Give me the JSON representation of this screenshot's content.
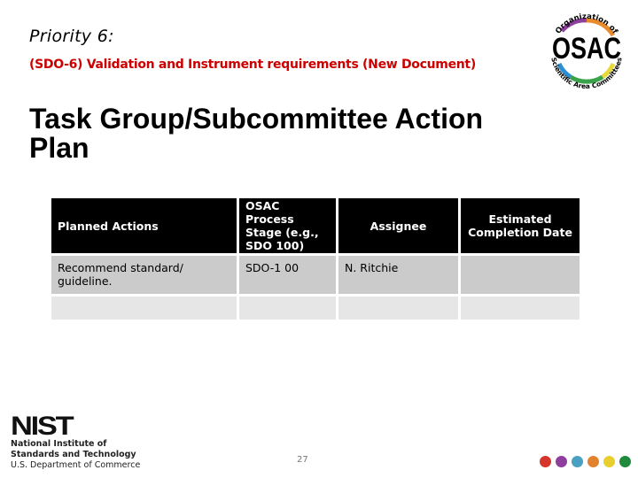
{
  "header": {
    "priority": "Priority 6:",
    "subtitle": "(SDO-6) Validation and Instrument requirements (New Document)",
    "title": "Task Group/Subcommittee Action Plan"
  },
  "osac_logo": {
    "acronym": "OSAC",
    "top_text": "Organization of",
    "bottom_text": "Scientific Area Committees",
    "ring_colors": [
      "#8e3f9e",
      "#e98b2a",
      "#e8d93a",
      "#3aa34a",
      "#2b8fd6"
    ]
  },
  "table": {
    "headers": [
      "Planned Actions",
      "OSAC Process Stage (e.g., SDO 100)",
      "Assignee",
      "Estimated Completion Date"
    ],
    "rows": [
      [
        "Recommend standard/ guideline.",
        "SDO-1 00",
        "N. Ritchie",
        ""
      ],
      [
        "",
        "",
        "",
        ""
      ]
    ]
  },
  "footer": {
    "nist_logo": "NIST",
    "nist_line1": "National Institute of",
    "nist_line2": "Standards and Technology",
    "nist_line3": "U.S. Department of Commerce",
    "page_number": "27",
    "dot_colors": [
      "#d6352b",
      "#8e3f9e",
      "#4aa0c0",
      "#e2822e",
      "#e8cf2e",
      "#1f8a3c"
    ]
  }
}
